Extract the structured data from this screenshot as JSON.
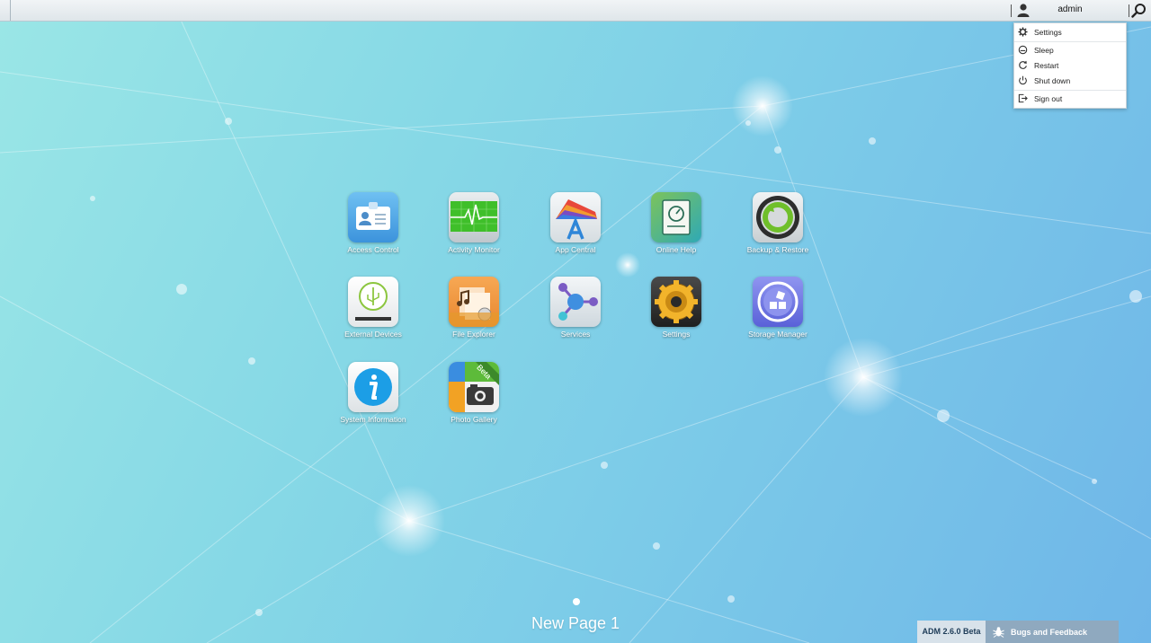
{
  "topbar": {
    "username": "admin"
  },
  "user_menu": {
    "items": [
      {
        "label": "Settings",
        "icon": "gear-icon"
      },
      {
        "label": "Sleep",
        "icon": "sleep-icon"
      },
      {
        "label": "Restart",
        "icon": "restart-icon"
      },
      {
        "label": "Shut down",
        "icon": "power-icon"
      },
      {
        "label": "Sign out",
        "icon": "sign-out-icon"
      }
    ]
  },
  "apps": [
    {
      "label": "Access Control",
      "icon": "id-card-icon",
      "color": "#4aa3e6"
    },
    {
      "label": "Activity Monitor",
      "icon": "heartbeat-monitor-icon",
      "color": "#3fbf2a"
    },
    {
      "label": "App Central",
      "icon": "app-central-icon",
      "color": "#eef1f3"
    },
    {
      "label": "Online Help",
      "icon": "help-book-icon",
      "color": "#48b88e"
    },
    {
      "label": "Backup & Restore",
      "icon": "backup-icon",
      "color": "#555555"
    },
    {
      "label": "External Devices",
      "icon": "usb-icon",
      "color": "#f4f4f4"
    },
    {
      "label": "File Explorer",
      "icon": "file-explorer-icon",
      "color": "#f09a45"
    },
    {
      "label": "Services",
      "icon": "services-icon",
      "color": "#e8edf1"
    },
    {
      "label": "Settings",
      "icon": "settings-gear-icon",
      "color": "#2f2f2f"
    },
    {
      "label": "Storage Manager",
      "icon": "storage-icon",
      "color": "#7a7fe8"
    },
    {
      "label": "System Information",
      "icon": "info-icon",
      "color": "#f2f4f5"
    },
    {
      "label": "Photo Gallery",
      "icon": "photo-gallery-icon",
      "color": "#f5f5f5",
      "badge": "Beta"
    }
  ],
  "page": {
    "title": "New Page 1"
  },
  "footer": {
    "version": "ADM 2.6.0 Beta",
    "feedback": "Bugs and Feedback"
  }
}
